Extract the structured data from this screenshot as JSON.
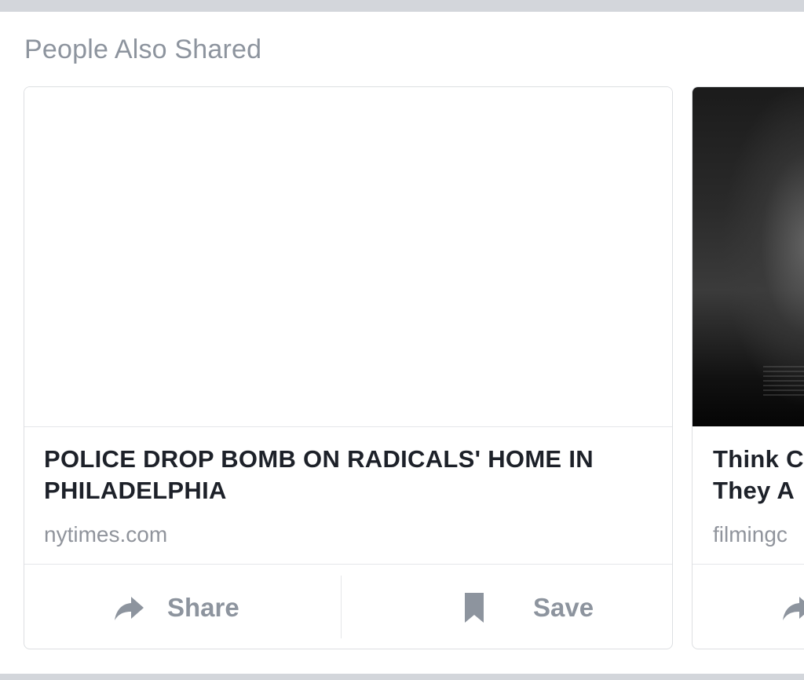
{
  "section": {
    "title": "People Also Shared"
  },
  "cards": [
    {
      "headline": "POLICE DROP BOMB ON RADICALS' HOME IN PHILADELPHIA",
      "source": "nytimes.com",
      "share_label": "Share",
      "save_label": "Save"
    },
    {
      "headline": "Think C\nThey A",
      "source": "filmingc"
    }
  ],
  "icons": {
    "share": "share-arrow-icon",
    "save": "bookmark-icon"
  },
  "colors": {
    "divider": "#d3d6db",
    "muted_text": "#8d949e",
    "headline_text": "#1d2129",
    "card_border": "#dddfe2"
  }
}
